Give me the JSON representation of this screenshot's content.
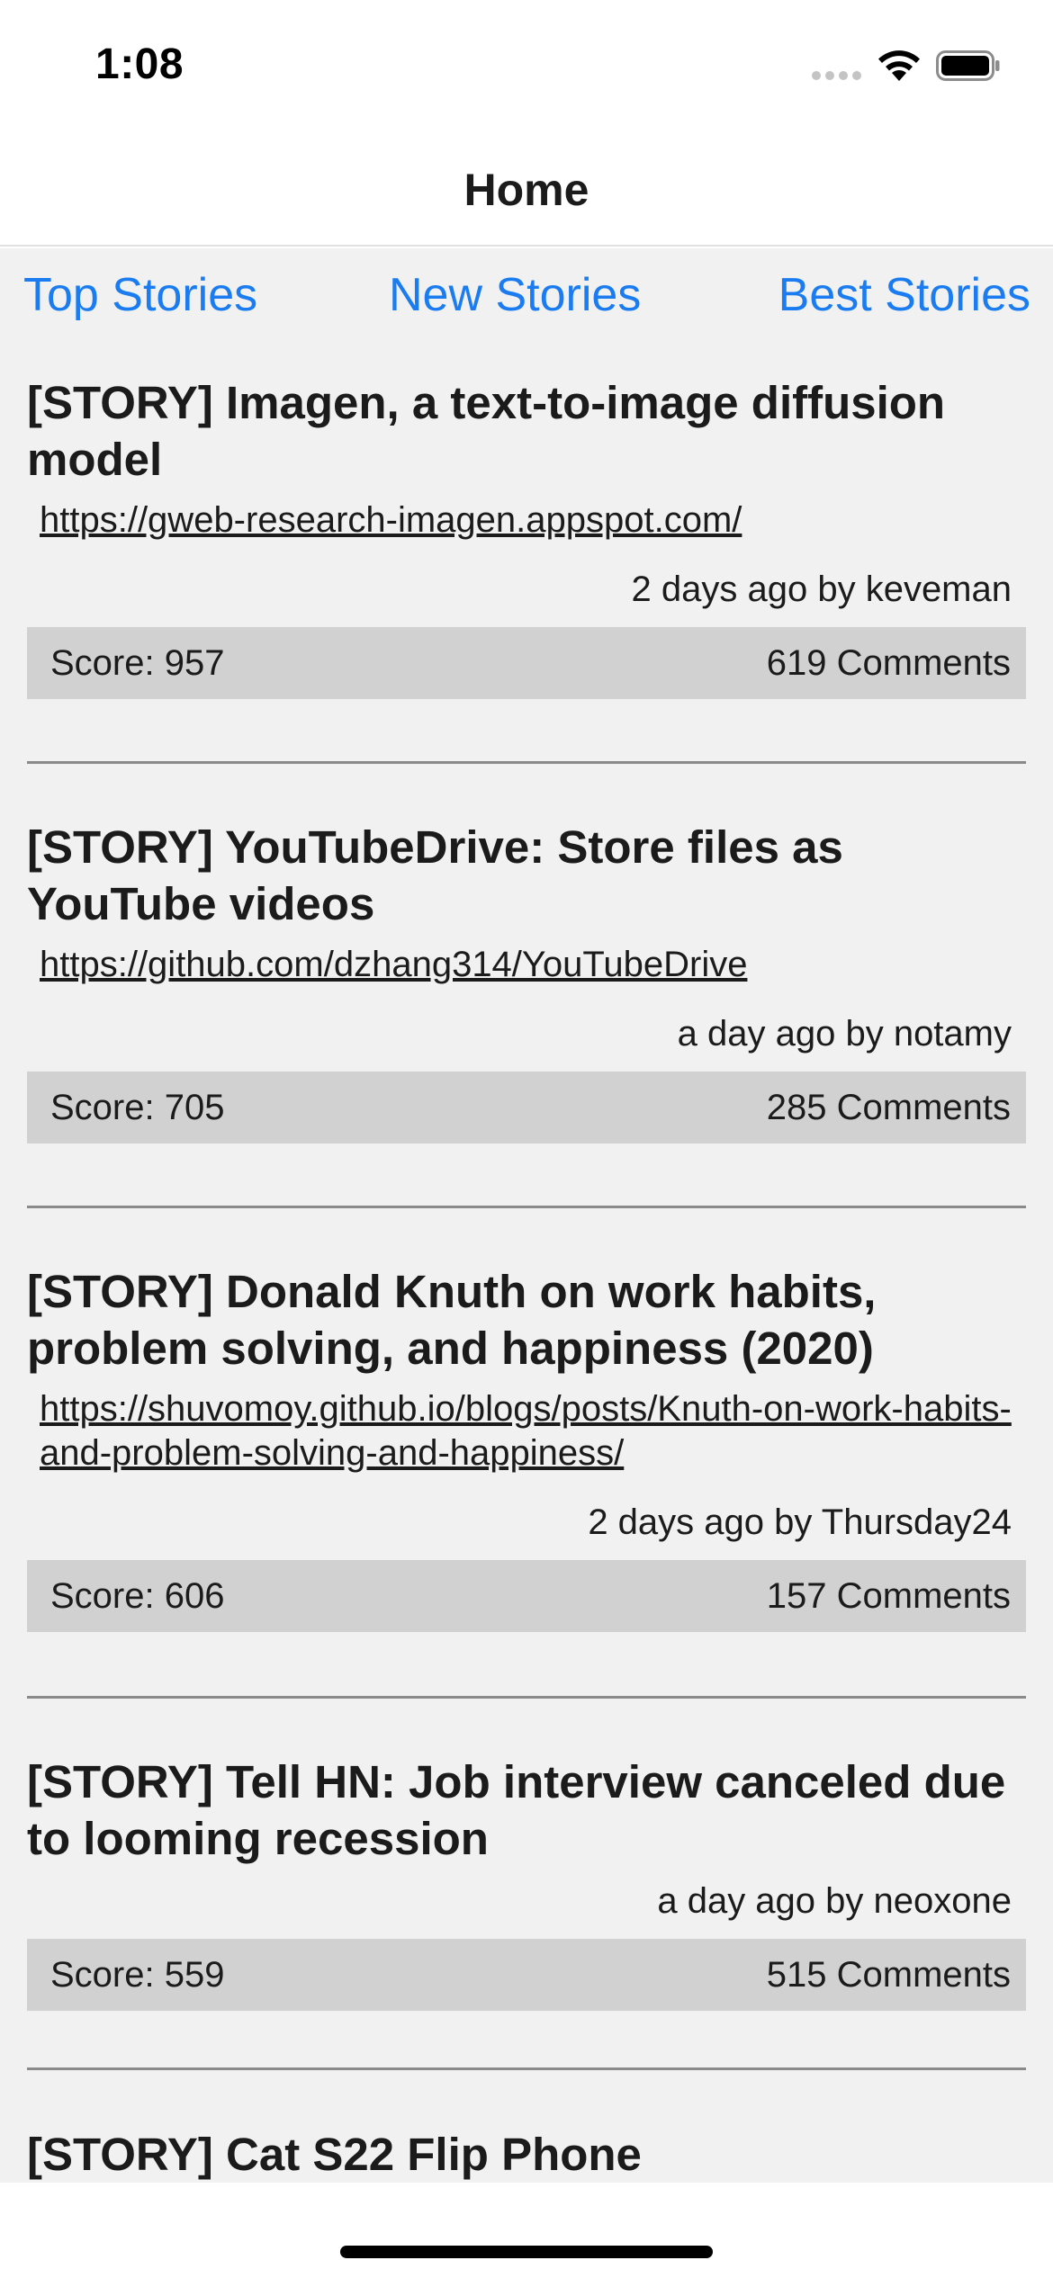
{
  "status_bar": {
    "time": "1:08"
  },
  "nav": {
    "title": "Home"
  },
  "tabs": [
    {
      "label": "Top Stories"
    },
    {
      "label": "New Stories"
    },
    {
      "label": "Best Stories"
    }
  ],
  "stories": [
    {
      "title": "[STORY] Imagen, a text-to-image diffusion model",
      "url": "https://gweb-research-imagen.appspot.com/",
      "meta": "2 days ago by keveman",
      "score": "Score: 957",
      "comments": "619 Comments"
    },
    {
      "title": "[STORY] YouTubeDrive: Store files as YouTube videos",
      "url": "https://github.com/dzhang314/YouTubeDrive",
      "meta": "a day ago by notamy",
      "score": "Score: 705",
      "comments": "285 Comments"
    },
    {
      "title": "[STORY] Donald Knuth on work habits, problem solving, and happiness (2020)",
      "url": "https://shuvomoy.github.io/blogs/posts/Knuth-on-work-habits-and-problem-solving-and-happiness/",
      "meta": "2 days ago by Thursday24",
      "score": "Score: 606",
      "comments": "157 Comments"
    },
    {
      "title": "[STORY] Tell HN: Job interview canceled due to looming recession",
      "meta": "a day ago by neoxone",
      "score": "Score: 559",
      "comments": "515 Comments"
    },
    {
      "title": "[STORY] Cat S22 Flip Phone"
    }
  ],
  "colors": {
    "link_blue": "#1a7cf0",
    "background": "#f1f1f1",
    "score_bar": "#d1d1d1"
  }
}
